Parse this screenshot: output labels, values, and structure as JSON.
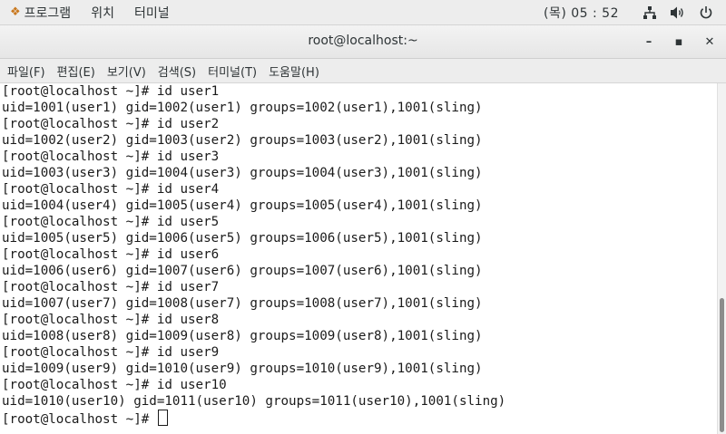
{
  "topbar": {
    "apps_label": "프로그램",
    "places_label": "위치",
    "terminal_label": "터미널",
    "clock": "(목) 05 : 52"
  },
  "window": {
    "title": "root@localhost:~",
    "minimize": "–",
    "maximize": "▪",
    "close": "✕"
  },
  "menubar": {
    "items": [
      "파일(F)",
      "편집(E)",
      "보기(V)",
      "검색(S)",
      "터미널(T)",
      "도움말(H)"
    ]
  },
  "terminal": {
    "lines": [
      "[root@localhost ~]# id user1",
      "uid=1001(user1) gid=1002(user1) groups=1002(user1),1001(sling)",
      "[root@localhost ~]# id user2",
      "uid=1002(user2) gid=1003(user2) groups=1003(user2),1001(sling)",
      "[root@localhost ~]# id user3",
      "uid=1003(user3) gid=1004(user3) groups=1004(user3),1001(sling)",
      "[root@localhost ~]# id user4",
      "uid=1004(user4) gid=1005(user4) groups=1005(user4),1001(sling)",
      "[root@localhost ~]# id user5",
      "uid=1005(user5) gid=1006(user5) groups=1006(user5),1001(sling)",
      "[root@localhost ~]# id user6",
      "uid=1006(user6) gid=1007(user6) groups=1007(user6),1001(sling)",
      "[root@localhost ~]# id user7",
      "uid=1007(user7) gid=1008(user7) groups=1008(user7),1001(sling)",
      "[root@localhost ~]# id user8",
      "uid=1008(user8) gid=1009(user8) groups=1009(user8),1001(sling)",
      "[root@localhost ~]# id user9",
      "uid=1009(user9) gid=1010(user9) groups=1010(user9),1001(sling)",
      "[root@localhost ~]# id user10",
      "uid=1010(user10) gid=1011(user10) groups=1011(user10),1001(sling)"
    ],
    "prompt": "[root@localhost ~]# "
  }
}
